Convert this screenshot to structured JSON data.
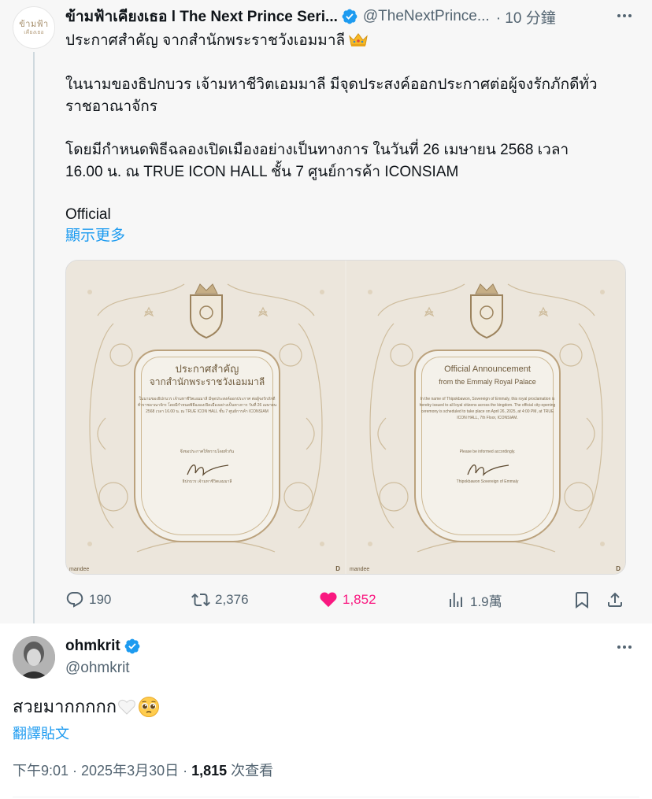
{
  "parent_tweet": {
    "author_name": "ข้ามฟ้าเคียงเธอ l The Next Prince Seri...",
    "handle": "@TheNextPrince...",
    "time": "· 10 分鐘",
    "avatar_text_1": "ข้ามฟ้า",
    "avatar_text_2": "เคียงเธอ",
    "lines": [
      "ประกาศสำคัญ จากสำนักพระราชวังเอมมาลี",
      "ในนามของธิปกบวร เจ้ามหาชีวิตเอมมาลี มีจุดประสงค์ออกประกาศต่อผู้จงรักภักดีทั่ว",
      "ราชอาณาจักร",
      "โดยมีกำหนดพิธีฉลองเปิดเมืองอย่างเป็นทางการ ในวันที่ 26 เมษายน 2568 เวลา",
      "16.00 น. ณ TRUE ICON HALL ชั้น 7 ศูนย์การค้า ICONSIAM",
      "Official"
    ],
    "show_more": "顯示更多",
    "media": {
      "left": {
        "title_1": "ประกาศสำคัญ",
        "title_2": "จากสำนักพระราชวังเอมมาลี",
        "body": "ในนามของธิปกบวร เจ้ามหาชีวิตเอมมาลี มีจุดประสงค์ออกประกาศ ต่อผู้จงรักภักดีทั่วราชอาณาจักร โดยมีกำหนดพิธีฉลองเปิดเมืองอย่างเป็นทางการ วันที่ 26 เมษายน 2568 เวลา 16.00 น. ณ TRUE ICON HALL ชั้น 7 ศูนย์การค้า ICONSIAM",
        "sub": "จึงขอประกาศให้ทราบโดยทั่วกัน",
        "sign": "ธิปกบวร เจ้ามหาชีวิตเอมมาลี",
        "logo_left": "mandee",
        "logo_right": "D"
      },
      "right": {
        "title_1": "Official Announcement",
        "title_2": "from the Emmaly Royal Palace",
        "body": "In the name of Thipokbawon, Sovereign of Emmaly, this royal proclamation is hereby issued to all loyal citizens across the kingdom. The official city-opening ceremony is scheduled to take place on April 26, 2025, at 4:00 PM, at TRUE ICON HALL, 7th Floor, ICONSIAM.",
        "sub": "Please be informed accordingly.",
        "sign": "Thipokbawon Sovereign of Emmaly",
        "logo_left": "mandee",
        "logo_right": "D"
      }
    },
    "stats": {
      "replies": "190",
      "reposts": "2,376",
      "likes": "1,852",
      "views": "1.9萬"
    }
  },
  "reply_tweet": {
    "author_name": "ohmkrit",
    "handle": "@ohmkrit",
    "text": "สวยมากกกกก",
    "translate": "翻譯貼文",
    "time": "下午9:01 · 2025年3月30日 · ",
    "views_count": "1,815",
    "views_label": " 次查看"
  },
  "colors": {
    "accent": "#1d9bf0",
    "like": "#f91880",
    "muted": "#536471",
    "gold": "#bba27d"
  },
  "icons": [
    "verified-badge-icon",
    "crown-emoji-icon",
    "more-icon",
    "reply-icon",
    "repost-icon",
    "heart-icon",
    "views-icon",
    "bookmark-icon",
    "share-icon",
    "white-heart-emoji-icon",
    "pleading-face-emoji-icon"
  ]
}
